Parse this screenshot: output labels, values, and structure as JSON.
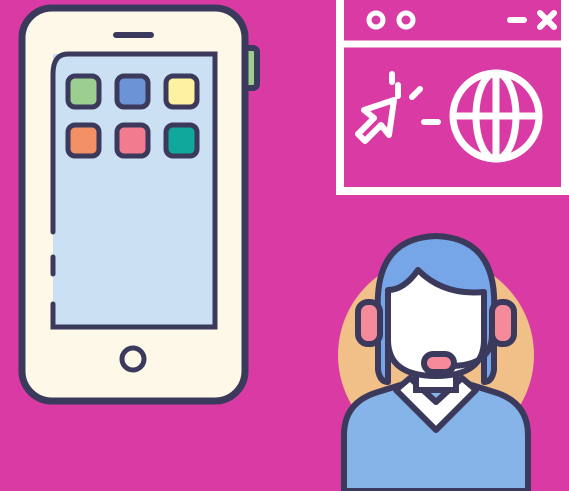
{
  "colors": {
    "background": "#d93aa3",
    "outline": "#3b3a5c",
    "phone_body": "#fdf8e8",
    "phone_screen": "#cce0f3",
    "app_green": "#9ccf8f",
    "app_blue": "#6b93d6",
    "app_yellow": "#fcf2a0",
    "app_orange": "#f28f64",
    "app_pink": "#f27b90",
    "app_teal": "#10a89c",
    "browser_frame": "#ffffff",
    "agent_hair": "#76a6e8",
    "agent_skin": "#ffffff",
    "agent_halo": "#f0c088",
    "agent_headset": "#f48a9a",
    "agent_shirt": "#86b3e8"
  },
  "illustrations": [
    "smartphone-app-grid",
    "browser-window-cursor-globe",
    "customer-support-agent-headset"
  ]
}
